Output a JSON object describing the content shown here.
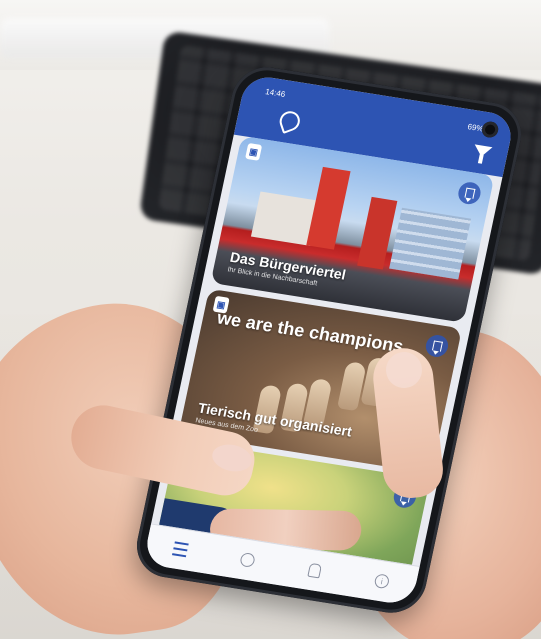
{
  "status_bar": {
    "time": "14:46",
    "battery": "69% ▮"
  },
  "cards": [
    {
      "title": "Das Bürgerviertel",
      "subtitle": "Ihr Blick in die Nachbarschaft"
    },
    {
      "overlay": "we are the champions",
      "title": "Tierisch gut organisiert",
      "subtitle": "Neues aus dem Zoo"
    },
    {
      "title": "",
      "subtitle": ""
    }
  ],
  "icons": {
    "filter": "filter-icon",
    "bookmark": "bookmark-icon",
    "tag": "tag-icon",
    "menu": "menu-icon",
    "explore": "compass-icon",
    "profile": "user-icon",
    "info": "info-icon"
  },
  "colors": {
    "header": "#2d54b3",
    "tabbar": "#f7f8fb"
  }
}
